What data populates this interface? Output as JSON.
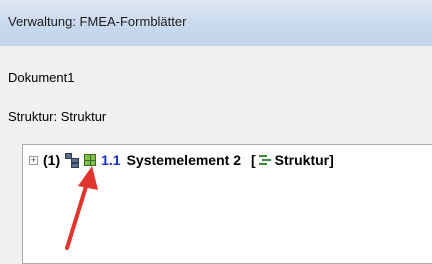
{
  "window": {
    "title": "Verwaltung: FMEA-Formblätter"
  },
  "document": {
    "name": "Dokument1"
  },
  "structure": {
    "label": "Struktur: Struktur"
  },
  "tree": {
    "row": {
      "expander": "⊞",
      "index": "(1)",
      "tree_icon": "structure-tree-icon",
      "grid_icon": "element-grid-icon",
      "item_number": "1.1",
      "item_name": "Systemelement 2",
      "tag_open": "[",
      "tag_icon": "structure-icon",
      "tag_label": "Struktur",
      "tag_close": "]"
    }
  },
  "annotation": {
    "arrow_color": "#e0342c"
  }
}
